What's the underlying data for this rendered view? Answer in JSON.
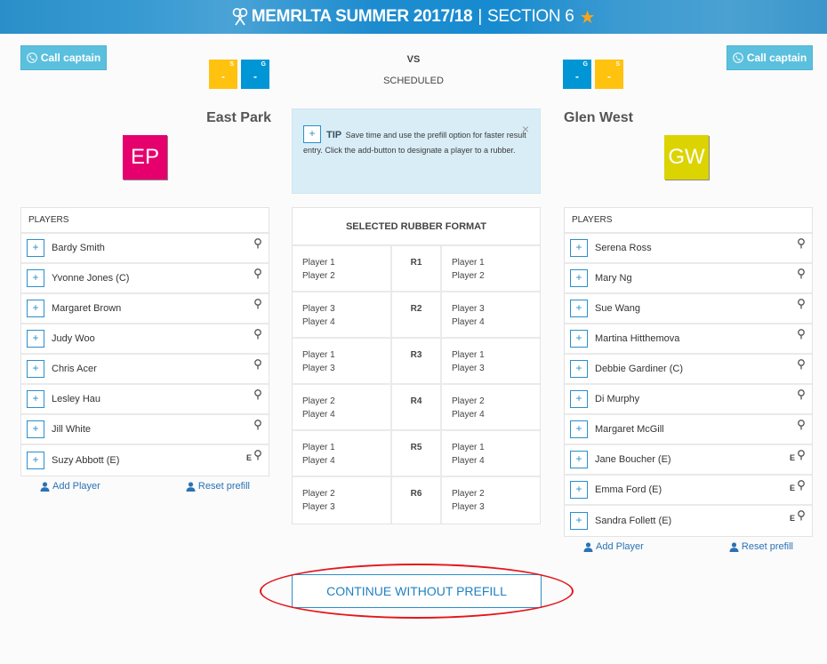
{
  "banner": {
    "title_bold": "MEMRLTA SUMMER 2017/18",
    "separator": "|",
    "section": "SECTION 6",
    "icons": [
      "racket-icon",
      "star-icon"
    ]
  },
  "match": {
    "vs_label": "VS",
    "status": "SCHEDULED"
  },
  "home": {
    "call_label": "Call captain",
    "name": "East Park",
    "logo_text": "EP",
    "logo_color": "#e5006e",
    "scores": [
      {
        "tag": "S",
        "value": "-",
        "color": "#ffc20e"
      },
      {
        "tag": "G",
        "value": "-",
        "color": "#0096d6"
      }
    ],
    "players_header": "PLAYERS",
    "players": [
      {
        "name": "Bardy Smith",
        "flag": ""
      },
      {
        "name": "Yvonne Jones (C)",
        "flag": ""
      },
      {
        "name": "Margaret Brown",
        "flag": ""
      },
      {
        "name": "Judy Woo",
        "flag": ""
      },
      {
        "name": "Chris Acer",
        "flag": ""
      },
      {
        "name": "Lesley Hau",
        "flag": ""
      },
      {
        "name": "Jill White",
        "flag": ""
      },
      {
        "name": "Suzy Abbott (E)",
        "flag": "E"
      }
    ],
    "add_player_label": "Add Player",
    "reset_prefill_label": "Reset prefill"
  },
  "away": {
    "call_label": "Call captain",
    "name": "Glen West",
    "logo_text": "GW",
    "logo_color": "#dbd400",
    "scores": [
      {
        "tag": "G",
        "value": "-",
        "color": "#0096d6"
      },
      {
        "tag": "S",
        "value": "-",
        "color": "#ffc20e"
      }
    ],
    "players_header": "PLAYERS",
    "players": [
      {
        "name": "Serena Ross",
        "flag": ""
      },
      {
        "name": "Mary Ng",
        "flag": ""
      },
      {
        "name": "Sue Wang",
        "flag": ""
      },
      {
        "name": "Martina Hitthemova",
        "flag": ""
      },
      {
        "name": "Debbie Gardiner (C)",
        "flag": ""
      },
      {
        "name": "Di Murphy",
        "flag": ""
      },
      {
        "name": "Margaret McGill",
        "flag": ""
      },
      {
        "name": "Jane Boucher (E)",
        "flag": "E"
      },
      {
        "name": "Emma Ford (E)",
        "flag": "E"
      },
      {
        "name": "Sandra Follett (E)",
        "flag": "E"
      }
    ],
    "add_player_label": "Add Player",
    "reset_prefill_label": "Reset prefill"
  },
  "tip": {
    "plus": "+",
    "label": "TIP",
    "text": "Save time and use the prefill option for faster result entry. Click the add-button to designate a player to a rubber.",
    "close": "×"
  },
  "format": {
    "header": "SELECTED RUBBER FORMAT",
    "rubbers": [
      {
        "home": [
          "Player 1",
          "Player 2"
        ],
        "label": "R1",
        "away": [
          "Player 1",
          "Player 2"
        ]
      },
      {
        "home": [
          "Player 3",
          "Player 4"
        ],
        "label": "R2",
        "away": [
          "Player 3",
          "Player 4"
        ]
      },
      {
        "home": [
          "Player 1",
          "Player 3"
        ],
        "label": "R3",
        "away": [
          "Player 1",
          "Player 3"
        ]
      },
      {
        "home": [
          "Player 2",
          "Player 4"
        ],
        "label": "R4",
        "away": [
          "Player 2",
          "Player 4"
        ]
      },
      {
        "home": [
          "Player 1",
          "Player 4"
        ],
        "label": "R5",
        "away": [
          "Player 1",
          "Player 4"
        ]
      },
      {
        "home": [
          "Player 2",
          "Player 3"
        ],
        "label": "R6",
        "away": [
          "Player 2",
          "Player 3"
        ]
      }
    ]
  },
  "continue_label": "CONTINUE WITHOUT PREFILL",
  "colors": {
    "accent": "#2b8fc9",
    "call_button": "#5bc0de",
    "tip_bg": "#d9edf7",
    "highlight_ellipse": "#e4161b"
  }
}
